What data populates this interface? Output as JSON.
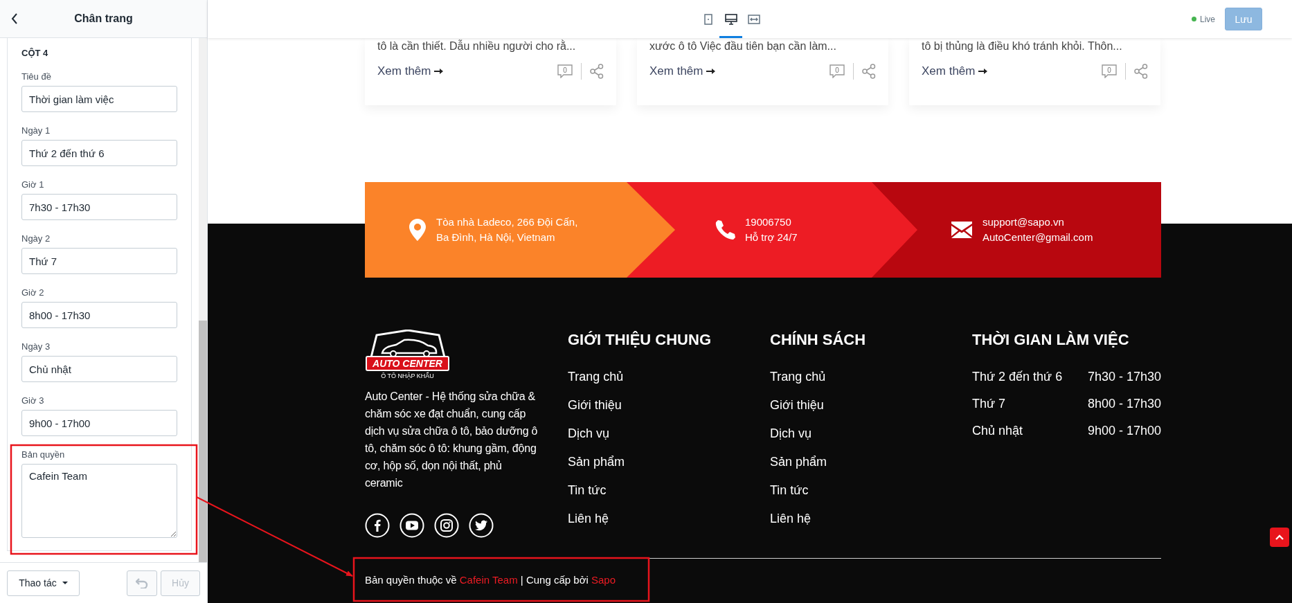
{
  "sidebar": {
    "title": "Chân trang",
    "section": "CỘT 4",
    "fields": [
      {
        "kind": "input",
        "label": "Tiêu đề",
        "value": "Thời gian làm việc"
      },
      {
        "kind": "input",
        "label": "Ngày 1",
        "value": "Thứ 2 đến thứ 6"
      },
      {
        "kind": "input",
        "label": "Giờ 1",
        "value": "7h30 - 17h30"
      },
      {
        "kind": "input",
        "label": "Ngày 2",
        "value": "Thứ 7"
      },
      {
        "kind": "input",
        "label": "Giờ 2",
        "value": "8h00 - 17h30"
      },
      {
        "kind": "input",
        "label": "Ngày 3",
        "value": "Chủ nhật"
      },
      {
        "kind": "input",
        "label": "Giờ 3",
        "value": "9h00 - 17h00"
      },
      {
        "kind": "textarea",
        "label": "Bản quyền",
        "value": "Cafein Team"
      }
    ],
    "actions_button": "Thao tác",
    "undo_button": {
      "disabled": true
    },
    "cancel_button": {
      "label": "Hủy",
      "disabled": true
    }
  },
  "toolbar": {
    "devices": [
      {
        "kind": "mobile",
        "selected": false
      },
      {
        "kind": "desktop",
        "selected": true
      },
      {
        "kind": "fullwidth",
        "selected": false
      }
    ],
    "status": "Live",
    "save_button": {
      "label": "Lưu",
      "disabled": true
    }
  },
  "preview": {
    "cards": [
      {
        "excerpt": "tô là cần thiết. Dẫu nhiều người cho rằ...",
        "link": "Xem thêm",
        "comments": "0"
      },
      {
        "excerpt": "xước ô tô Việc đầu tiên bạn cần làm...",
        "link": "Xem thêm",
        "comments": "0"
      },
      {
        "excerpt": "tô bị thủng là điều khó tránh khỏi. Thôn...",
        "link": "Xem thêm",
        "comments": "0"
      }
    ],
    "contacts": [
      {
        "kind": "address",
        "lines": [
          "Tòa nhà Ladeco, 266 Đội Cấn,",
          "Ba Đình, Hà Nội, Vietnam"
        ]
      },
      {
        "kind": "phone",
        "lines": [
          "19006750",
          "Hỗ trợ 24/7"
        ]
      },
      {
        "kind": "email",
        "lines": [
          "support@sapo.vn",
          "AutoCenter@gmail.com"
        ]
      }
    ],
    "footer": {
      "logo_title": "AUTO CENTER",
      "logo_tagline": "Ô TÔ NHẬP KHẨU",
      "description": "Auto Center - Hệ thống sửa chữa & chăm sóc xe đạt chuẩn, cung cấp dịch vụ sửa chữa ô tô, bảo dưỡng ô tô, chăm sóc ô tô: khung gầm, động cơ, hộp số, dọn nội thất, phủ ceramic",
      "socials": [
        {
          "kind": "facebook"
        },
        {
          "kind": "youtube"
        },
        {
          "kind": "instagram"
        },
        {
          "kind": "twitter"
        }
      ],
      "columns": [
        {
          "title": "GIỚI THIỆU CHUNG",
          "links": [
            "Trang chủ",
            "Giới thiệu",
            "Dịch vụ",
            "Sản phẩm",
            "Tin tức",
            "Liên hệ"
          ]
        },
        {
          "title": "CHÍNH SÁCH",
          "links": [
            "Trang chủ",
            "Giới thiệu",
            "Dịch vụ",
            "Sản phẩm",
            "Tin tức",
            "Liên hệ"
          ]
        }
      ],
      "hours": {
        "title": "THỜI GIAN LÀM VIỆC",
        "rows": [
          {
            "day": "Thứ 2 đến thứ 6",
            "time": "7h30 - 17h30"
          },
          {
            "day": "Thứ 7",
            "time": "8h00 - 17h30"
          },
          {
            "day": "Chủ nhật",
            "time": "9h00 - 17h00"
          }
        ]
      },
      "copyright": [
        {
          "text": "Bản quyền thuộc về ",
          "highlight": false
        },
        {
          "text": "Cafein Team",
          "highlight": true
        },
        {
          "text": " | Cung cấp bởi ",
          "highlight": false
        },
        {
          "text": "Sapo",
          "highlight": true
        }
      ]
    }
  }
}
